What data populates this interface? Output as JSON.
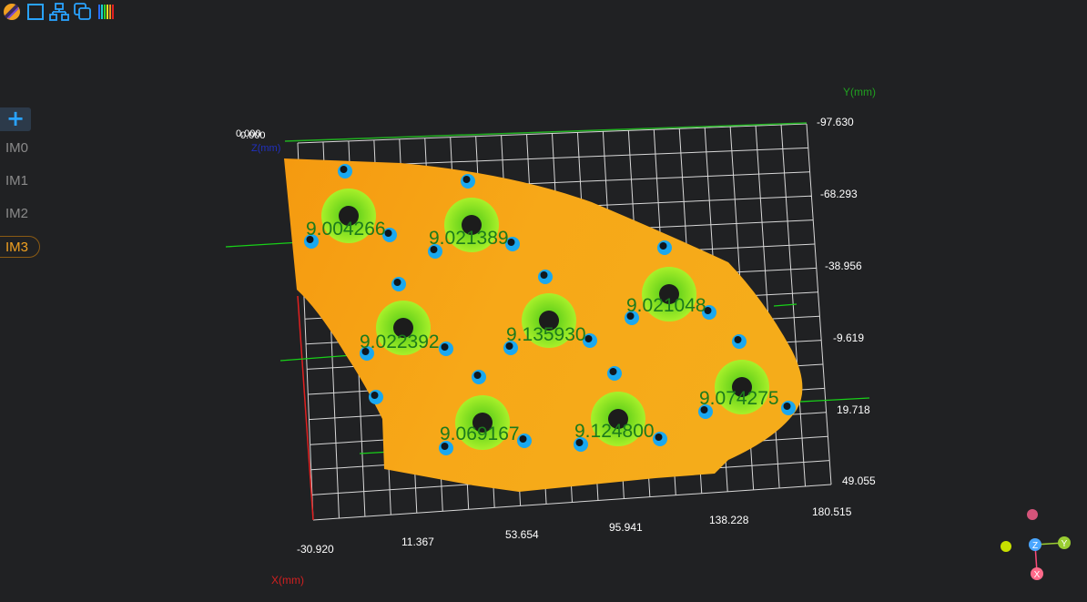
{
  "toolbar": {
    "icons": [
      "palette-icon",
      "box-view-icon",
      "hierarchy-icon",
      "copy-icon",
      "color-bar-icon"
    ]
  },
  "sidebar": {
    "add_label": "+",
    "items": [
      {
        "label": "IM0",
        "active": false
      },
      {
        "label": "IM1",
        "active": false
      },
      {
        "label": "IM2",
        "active": false
      },
      {
        "label": "IM3",
        "active": true
      }
    ]
  },
  "axes": {
    "x_title": "X(mm)",
    "y_title": "Y(mm)",
    "z_title": "Z(mm)",
    "x_ticks": [
      "-30.920",
      "11.367",
      "53.654",
      "95.941",
      "138.228",
      "180.515"
    ],
    "y_ticks": [
      "-97.630",
      "-68.293",
      "-38.956",
      "-9.619",
      "19.718",
      "49.055"
    ],
    "overlap_label": "0.000"
  },
  "measurements": [
    "9.004266",
    "9.021389",
    "9.021048",
    "9.022392",
    "9.135930",
    "9.069167",
    "9.124800",
    "9.074275"
  ],
  "gizmo": {
    "x": "X",
    "y": "Y",
    "z": "Z"
  },
  "colors": {
    "part": "#f5a214",
    "ring": "#8de821",
    "hole": "#1aa8f0",
    "label": "#1c7a1c",
    "grid": "#d8d8d8",
    "x_axis": "#e02020",
    "y_axis": "#20b020"
  }
}
